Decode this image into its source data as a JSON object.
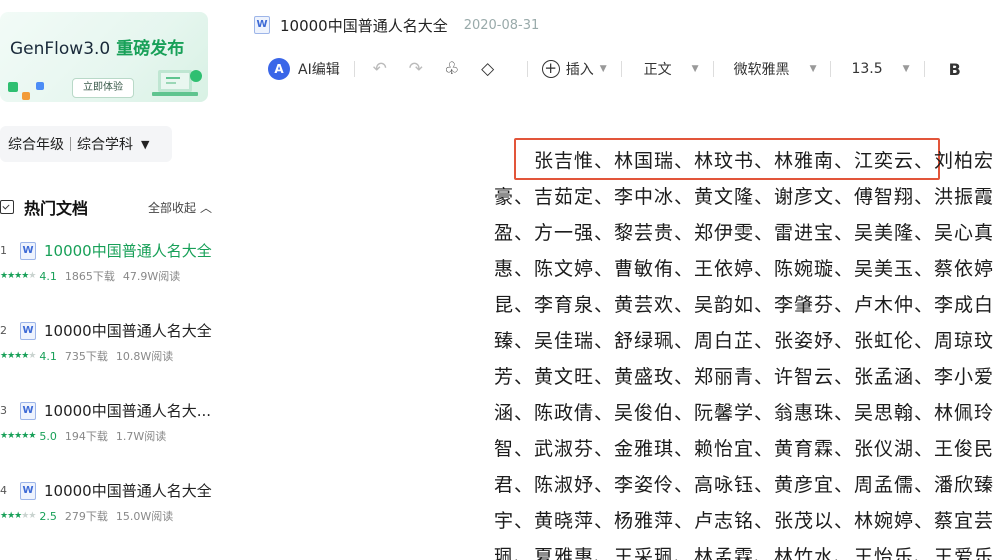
{
  "sidebar": {
    "promo": {
      "title": "GenFlow3.0",
      "highlight": "重磅发布",
      "button": "立即体验"
    },
    "filters": {
      "grade": "综合年级",
      "subject": "综合学科"
    },
    "hot_docs": {
      "title": "热门文档",
      "collapse_label": "全部收起",
      "items": [
        {
          "num": "1",
          "title": "10000中国普通人名大全",
          "rating": "4.1",
          "downloads": "1865下载",
          "reads": "47.9W阅读",
          "stars": 4,
          "active": true
        },
        {
          "num": "2",
          "title": "10000中国普通人名大全",
          "rating": "4.1",
          "downloads": "735下载",
          "reads": "10.8W阅读",
          "stars": 4,
          "active": false
        },
        {
          "num": "3",
          "title": "10000中国普通人名大...",
          "rating": "5.0",
          "downloads": "194下载",
          "reads": "1.7W阅读",
          "stars": 5,
          "active": false
        },
        {
          "num": "4",
          "title": "10000中国普通人名大全",
          "rating": "2.5",
          "downloads": "279下载",
          "reads": "15.0W阅读",
          "stars": 2.5,
          "active": false
        }
      ]
    }
  },
  "document": {
    "title": "10000中国普通人名大全",
    "date": "2020-08-31"
  },
  "toolbar": {
    "ai_edit": "AI编辑",
    "insert": "插入",
    "paragraph_style": "正文",
    "font": "微软雅黑",
    "font_size": "13.5",
    "bold": "B"
  },
  "content": {
    "lines": [
      "张吉惟、林国瑞、林玟书、林雅南、江奕云、刘柏宏",
      "豪、吉茹定、李中冰、黄文隆、谢彦文、傅智翔、洪振霞",
      "盈、方一强、黎芸贵、郑伊雯、雷进宝、吴美隆、吴心真",
      "惠、陈文婷、曹敏侑、王依婷、陈婉璇、吴美玉、蔡依婷",
      "昆、李育泉、黄芸欢、吴韵如、李肇芬、卢木仲、李成白",
      "臻、吴佳瑞、舒绿珮、周白芷、张姿妤、张虹伦、周琼玟",
      "芳、黄文旺、黄盛玫、郑丽青、许智云、张孟涵、李小爱",
      "涵、陈政倩、吴俊伯、阮馨学、翁惠珠、吴思翰、林佩玲",
      "智、武淑芬、金雅琪、赖怡宜、黄育霖、张仪湖、王俊民",
      "君、陈淑妤、李姿伶、高咏钰、黄彦宜、周孟儒、潘欣臻",
      "宇、黄晓萍、杨雅萍、卢志铭、张茂以、林婉婷、蔡宜芸",
      "珮、夏雅惠、王采珮、林孟霖、林竹水、王怡乐、王爱乐"
    ]
  },
  "colors": {
    "accent_green": "#18a058",
    "highlight_red": "#e2553a",
    "ai_blue": "#3a66e8"
  }
}
